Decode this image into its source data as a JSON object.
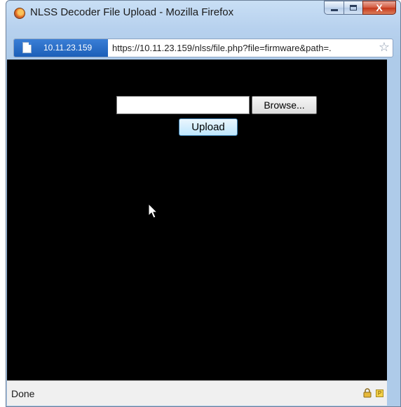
{
  "window": {
    "title": "NLSS Decoder File Upload - Mozilla Firefox",
    "minimize_glyph": "–",
    "close_glyph": "X"
  },
  "urlbar": {
    "identity": "10.11.23.159",
    "url": "https://10.11.23.159/nlss/file.php?file=firmware&path=."
  },
  "form": {
    "file_value": "",
    "browse_label": "Browse...",
    "upload_label": "Upload"
  },
  "statusbar": {
    "status": "Done"
  },
  "colors": {
    "content_bg": "#000000",
    "identity_bg": "#1c5fb8",
    "upload_bg": "#bee6fd"
  },
  "icons": [
    "firefox-icon",
    "page-icon",
    "bookmark-star-icon",
    "mouse-cursor-icon",
    "lock-icon",
    "plugin-icon"
  ]
}
